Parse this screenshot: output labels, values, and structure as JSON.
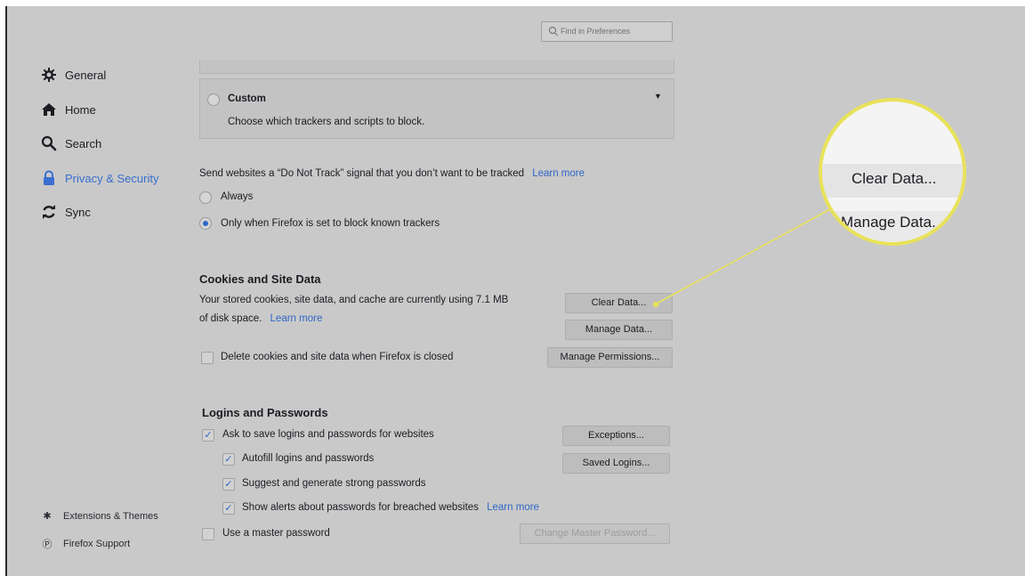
{
  "search": {
    "placeholder": "Find in Preferences"
  },
  "sidebar": {
    "items": [
      {
        "label": "General",
        "icon": "gear-icon"
      },
      {
        "label": "Home",
        "icon": "home-icon"
      },
      {
        "label": "Search",
        "icon": "search-icon"
      },
      {
        "label": "Privacy & Security",
        "icon": "lock-icon",
        "active": true
      },
      {
        "label": "Sync",
        "icon": "sync-icon"
      }
    ],
    "footer": [
      {
        "label": "Extensions & Themes",
        "icon": "puzzle-icon"
      },
      {
        "label": "Firefox Support",
        "icon": "help-icon"
      }
    ]
  },
  "tracking": {
    "custom_title": "Custom",
    "custom_desc": "Choose which trackers and scripts to block.",
    "dnt_text": "Send websites a “Do Not Track” signal that you don’t want to be tracked",
    "dnt_learn_more": "Learn more",
    "option_always": "Always",
    "option_only_when": "Only when Firefox is set to block known trackers",
    "selected": "only_when"
  },
  "cookies": {
    "heading": "Cookies and Site Data",
    "desc_line1": "Your stored cookies, site data, and cache are currently using 7.1 MB",
    "desc_line2": "of disk space.",
    "learn_more": "Learn more",
    "clear_data": "Clear Data...",
    "manage_data": "Manage Data...",
    "delete_on_close": "Delete cookies and site data when Firefox is closed",
    "delete_on_close_checked": false,
    "manage_permissions": "Manage Permissions..."
  },
  "logins": {
    "heading": "Logins and Passwords",
    "ask_to_save": "Ask to save logins and passwords for websites",
    "ask_to_save_checked": true,
    "autofill": "Autofill logins and passwords",
    "autofill_checked": true,
    "suggest": "Suggest and generate strong passwords",
    "suggest_checked": true,
    "alerts": "Show alerts about passwords for breached websites",
    "alerts_checked": true,
    "alerts_learn_more": "Learn more",
    "master": "Use a master password",
    "master_checked": false,
    "exceptions": "Exceptions...",
    "saved_logins": "Saved Logins...",
    "change_master": "Change Master Password..."
  },
  "magnifier": {
    "clear_data": "Clear Data...",
    "manage_data": "Manage Data.",
    "highlight_color": "#e8e25a"
  }
}
